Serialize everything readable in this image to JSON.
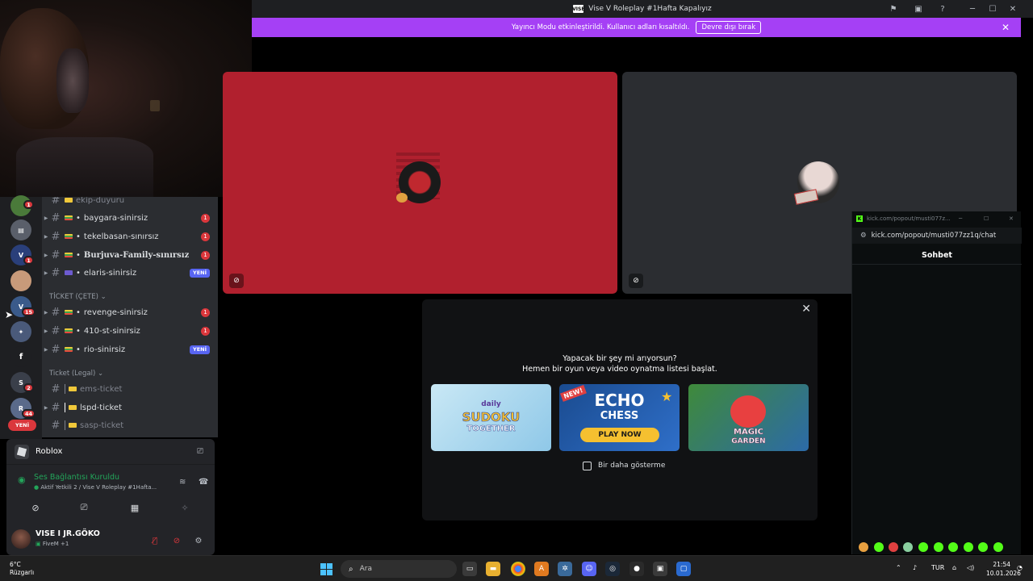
{
  "window": {
    "title": "Vise V Roleplay #1Hafta Kapalıyız",
    "app_icon": "VISE"
  },
  "notice": {
    "text": "Yayıncı Modu etkinleştirildi. Kullanıcı adları kısaltıldı.",
    "button": "Devre dışı bırak"
  },
  "servers": {
    "badges": [
      "1",
      "1",
      "15",
      "2",
      "44"
    ],
    "letter_f": "f",
    "yeni": "YENİ"
  },
  "channels": {
    "items": [
      {
        "name": "ekip-duyuru"
      },
      {
        "name": "baygara-sinirsiz",
        "mention": "1"
      },
      {
        "name": "tekelbasan-sınırsız",
        "mention": "1"
      },
      {
        "name": "Burjuva-Family-sınırsız",
        "mention": "1"
      },
      {
        "name": "elaris-sinirsiz",
        "tag": "YENİ"
      },
      {
        "name": "revenge-sinirsiz",
        "mention": "1"
      },
      {
        "name": "410-st-sinirsiz",
        "mention": "1"
      },
      {
        "name": "rio-sinirsiz",
        "tag": "YENİ"
      },
      {
        "name": "ems-ticket"
      },
      {
        "name": "lspd-ticket"
      },
      {
        "name": "sasp-ticket"
      }
    ],
    "categories": [
      "TİCKET (ÇETE)",
      "Ticket (Legal)"
    ]
  },
  "activity": {
    "game": "Roblox"
  },
  "voice": {
    "status": "Ses Bağlantısı Kuruldu",
    "channel": "Aktif Yetkili 2 / Vise V Roleplay #1Hafta..."
  },
  "user": {
    "name": "VISE I JR.GÖKO",
    "status": "FiveM +1"
  },
  "popup": {
    "title": "Yapacak bir şey mi arıyorsun?",
    "subtitle": "Hemen bir oyun veya video oynatma listesi başlat.",
    "games": [
      {
        "line1": "daily",
        "line2": "SUDOKU",
        "line3": "TOGETHER"
      },
      {
        "badge": "NEW!",
        "line1": "ECHO",
        "line2": "CHESS",
        "cta": "PLAY NOW"
      },
      {
        "line1": "MAGIC",
        "line2": "GARDEN"
      }
    ],
    "checkbox": "Bir daha gösterme"
  },
  "kick": {
    "tab_url": "kick.com/popout/musti077z...",
    "url": "kick.com/popout/musti077zz1q/chat",
    "header": "Sohbet"
  },
  "taskbar": {
    "temp": "6°C",
    "weather": "Rüzgarlı",
    "search": "Ara",
    "lang": "TUR",
    "time": "21:54",
    "date": "10.01.2026"
  },
  "colors": {
    "notice": "#a540f5",
    "tile_red": "#b1202e",
    "discord_green": "#23a55a",
    "mention_red": "#da373c",
    "blurple": "#5865f2",
    "kick_green": "#53fc18"
  }
}
